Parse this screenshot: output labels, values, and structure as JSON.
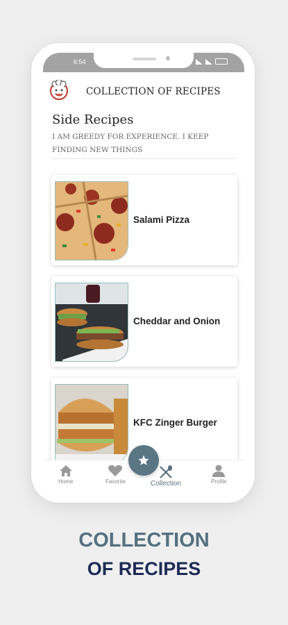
{
  "status_bar": {
    "time": "6:54"
  },
  "app": {
    "title": "COLLECTION OF RECIPES"
  },
  "section": {
    "title": "Side Recipes",
    "subtitle": "I AM GREEDY FOR EXPERIENCE. I KEEP FINDING NEW THINGS"
  },
  "recipes": [
    {
      "name": "Salami Pizza"
    },
    {
      "name": "Cheddar and Onion"
    },
    {
      "name": "KFC Zinger Burger"
    }
  ],
  "nav": {
    "home": "Home",
    "favorite": "Favorite",
    "collection": "Collection",
    "profile": "Profile"
  },
  "tagline": {
    "line1": "COLLECTION",
    "line2": "OF RECIPES"
  },
  "colors": {
    "accent": "#5a7584",
    "heading_blue": "#55707f",
    "heading_navy": "#1e2a56"
  }
}
